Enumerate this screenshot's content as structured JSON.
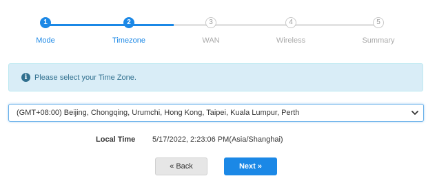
{
  "stepper": {
    "steps": [
      {
        "number": "1",
        "label": "Mode",
        "state": "done"
      },
      {
        "number": "2",
        "label": "Timezone",
        "state": "current"
      },
      {
        "number": "3",
        "label": "WAN",
        "state": "pending"
      },
      {
        "number": "4",
        "label": "Wireless",
        "state": "pending"
      },
      {
        "number": "5",
        "label": "Summary",
        "state": "pending"
      }
    ],
    "active_color": "#1b88e6",
    "inactive_color": "#c8c8c8"
  },
  "alert": {
    "icon": "info-icon",
    "icon_glyph": "i",
    "text": "Please select your Time Zone."
  },
  "timezone": {
    "selected": "(GMT+08:00) Beijing, Chongqing, Urumchi, Hong Kong, Taipei, Kuala Lumpur, Perth"
  },
  "local_time": {
    "label": "Local Time",
    "value": "5/17/2022, 2:23:06 PM(Asia/Shanghai)"
  },
  "buttons": {
    "back": "« Back",
    "next": "Next »"
  }
}
